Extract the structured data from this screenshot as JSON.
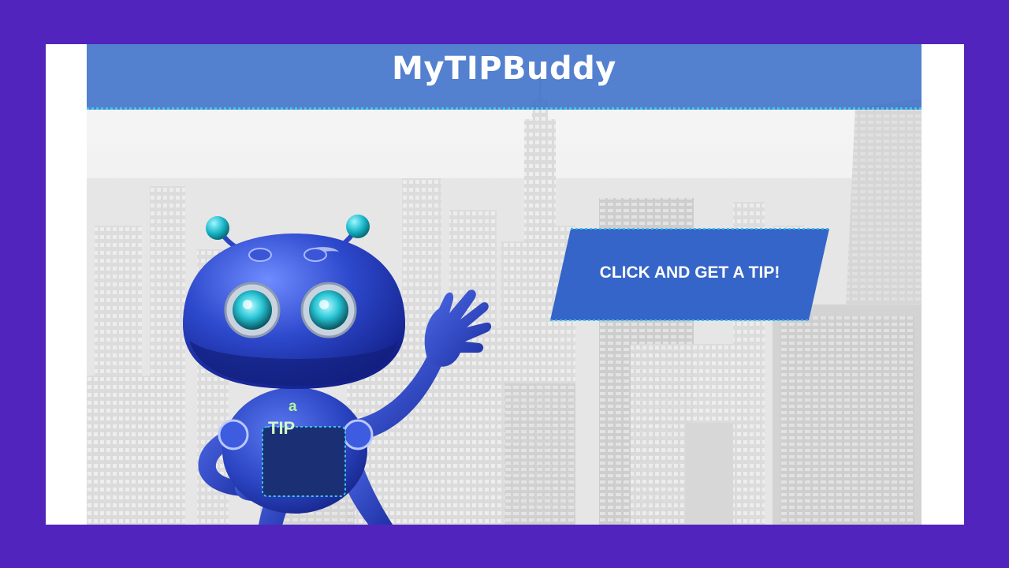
{
  "app": {
    "title": "MyTIPBuddy"
  },
  "tip_button": {
    "label": "CLICK AND GET A TIP!"
  },
  "mascot": {
    "icon": "robot-mascot-icon",
    "chest_small": "a",
    "chest_large": "TIP"
  },
  "colors": {
    "frame": "#5125bd",
    "header": "#3c70ca",
    "button": "#3565c8",
    "accent": "#38c6e8",
    "robot": "#2e49c8"
  }
}
